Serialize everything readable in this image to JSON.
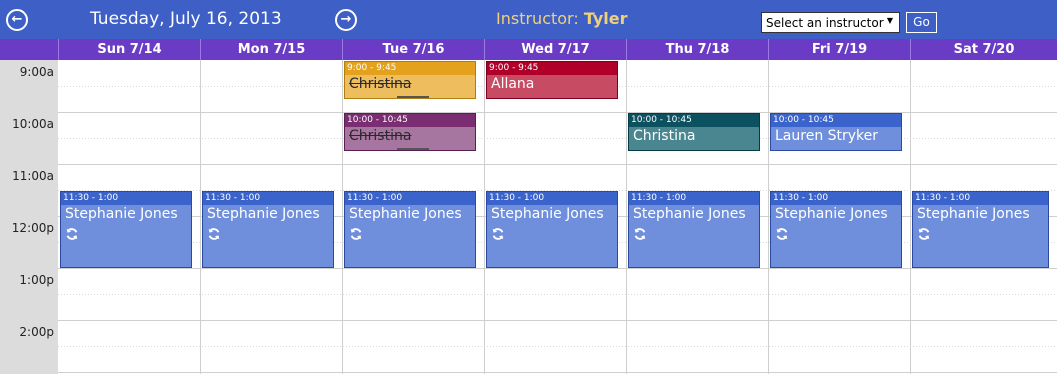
{
  "header": {
    "date_title": "Tuesday, July 16, 2013",
    "prev_label": "←",
    "next_label": "→",
    "instructor_label": "Instructor:",
    "instructor_name": "Tyler",
    "select_value": "Select an instructor",
    "go_label": "Go",
    "colors": {
      "header_bg": "#3d5fc6",
      "day_header_bg": "#6a3cc6",
      "instructor_text": "#f0d178"
    }
  },
  "days": [
    "Sun 7/14",
    "Mon 7/15",
    "Tue 7/16",
    "Wed 7/17",
    "Thu 7/18",
    "Fri 7/19",
    "Sat 7/20"
  ],
  "hours": [
    "9:00a",
    "10:00a",
    "11:00a",
    "12:00p",
    "1:00p",
    "2:00p"
  ],
  "events": [
    {
      "day": "Tue 7/16",
      "time": "9:00 - 9:45",
      "name": "Christina",
      "color": "orange",
      "strikethrough": true,
      "recurring": false
    },
    {
      "day": "Wed 7/17",
      "time": "9:00 - 9:45",
      "name": "Allana",
      "color": "red",
      "strikethrough": false,
      "recurring": false
    },
    {
      "day": "Tue 7/16",
      "time": "10:00 - 10:45",
      "name": "Christina",
      "color": "purple",
      "strikethrough": true,
      "recurring": false
    },
    {
      "day": "Thu 7/18",
      "time": "10:00 - 10:45",
      "name": "Christina",
      "color": "teal",
      "strikethrough": false,
      "recurring": false
    },
    {
      "day": "Fri 7/19",
      "time": "10:00 - 10:45",
      "name": "Lauren Stryker",
      "color": "blue",
      "strikethrough": false,
      "recurring": false
    },
    {
      "day": "Sun 7/14",
      "time": "11:30 - 1:00",
      "name": "Stephanie Jones",
      "color": "blue",
      "strikethrough": false,
      "recurring": true
    },
    {
      "day": "Mon 7/15",
      "time": "11:30 - 1:00",
      "name": "Stephanie Jones",
      "color": "blue",
      "strikethrough": false,
      "recurring": true
    },
    {
      "day": "Tue 7/16",
      "time": "11:30 - 1:00",
      "name": "Stephanie Jones",
      "color": "blue",
      "strikethrough": false,
      "recurring": true
    },
    {
      "day": "Wed 7/17",
      "time": "11:30 - 1:00",
      "name": "Stephanie Jones",
      "color": "blue",
      "strikethrough": false,
      "recurring": true
    },
    {
      "day": "Thu 7/18",
      "time": "11:30 - 1:00",
      "name": "Stephanie Jones",
      "color": "blue",
      "strikethrough": false,
      "recurring": true
    },
    {
      "day": "Fri 7/19",
      "time": "11:30 - 1:00",
      "name": "Stephanie Jones",
      "color": "blue",
      "strikethrough": false,
      "recurring": true
    },
    {
      "day": "Sat 7/20",
      "time": "11:30 - 1:00",
      "name": "Stephanie Jones",
      "color": "blue",
      "strikethrough": false,
      "recurring": true
    }
  ]
}
